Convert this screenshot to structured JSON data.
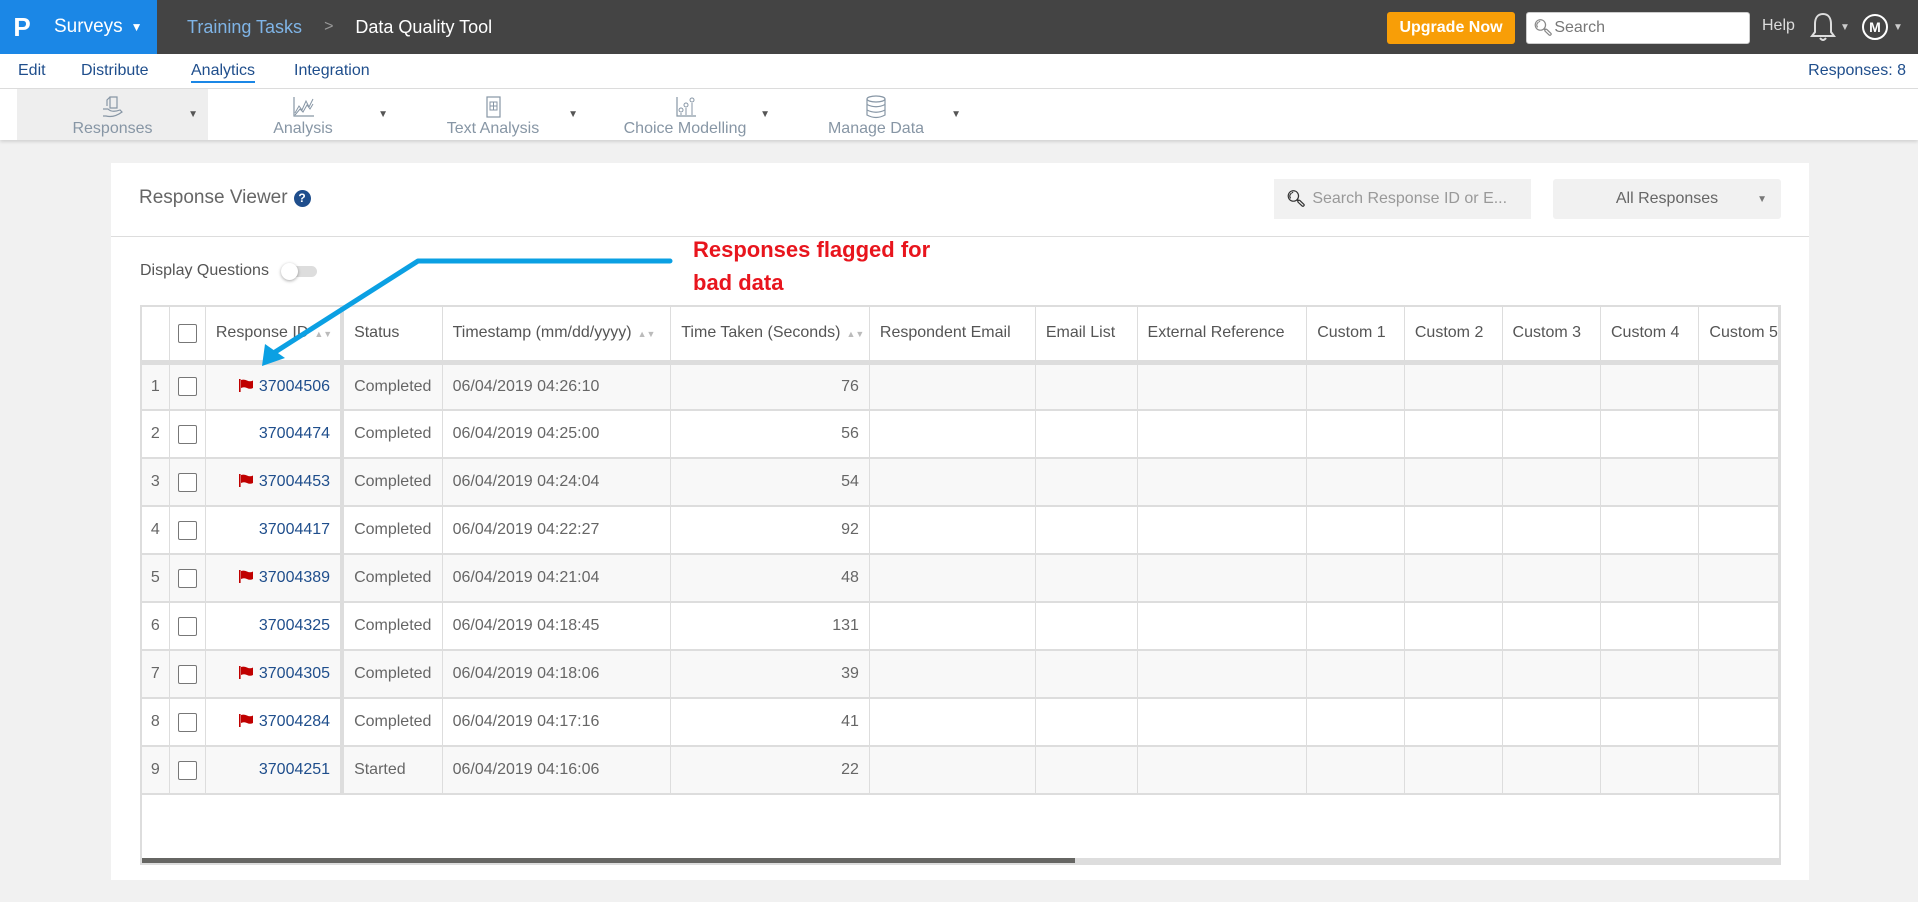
{
  "topbar": {
    "brand_logo": "P",
    "brand_label": "Surveys",
    "breadcrumb": [
      "Training Tasks",
      "Data Quality Tool"
    ],
    "breadcrumb_sep": ">",
    "upgrade_label": "Upgrade Now",
    "search_placeholder": "Search",
    "help_label": "Help",
    "avatar_initial": "M"
  },
  "subnav": {
    "items": [
      "Edit",
      "Distribute",
      "Analytics",
      "Integration"
    ],
    "active": "Analytics",
    "responses_count": "Responses: 8"
  },
  "toolbar": {
    "items": [
      {
        "label": "Responses",
        "icon": "responses-icon",
        "active": true
      },
      {
        "label": "Analysis",
        "icon": "analysis-chart-icon",
        "active": false
      },
      {
        "label": "Text Analysis",
        "icon": "text-analysis-icon",
        "active": false
      },
      {
        "label": "Choice Modelling",
        "icon": "choice-modelling-icon",
        "active": false
      },
      {
        "label": "Manage Data",
        "icon": "database-icon",
        "active": false
      }
    ]
  },
  "viewer": {
    "title": "Response Viewer",
    "help_icon": "?",
    "search_placeholder": "Search Response ID or E...",
    "filter_selected": "All Responses",
    "display_questions_label": "Display Questions",
    "display_questions_on": false
  },
  "table": {
    "columns": [
      "Response ID",
      "Status",
      "Timestamp (mm/dd/yyyy)",
      "Time Taken (Seconds)",
      "Respondent Email",
      "Email List",
      "External Reference",
      "Custom 1",
      "Custom 2",
      "Custom 3",
      "Custom 4",
      "Custom 5"
    ],
    "sortable": [
      "Response ID",
      "Timestamp (mm/dd/yyyy)",
      "Time Taken (Seconds)"
    ],
    "rows": [
      {
        "n": "1",
        "id": "37004506",
        "flagged": true,
        "status": "Completed",
        "timestamp": "06/04/2019 04:26:10",
        "time_taken": "76"
      },
      {
        "n": "2",
        "id": "37004474",
        "flagged": false,
        "status": "Completed",
        "timestamp": "06/04/2019 04:25:00",
        "time_taken": "56"
      },
      {
        "n": "3",
        "id": "37004453",
        "flagged": true,
        "status": "Completed",
        "timestamp": "06/04/2019 04:24:04",
        "time_taken": "54"
      },
      {
        "n": "4",
        "id": "37004417",
        "flagged": false,
        "status": "Completed",
        "timestamp": "06/04/2019 04:22:27",
        "time_taken": "92"
      },
      {
        "n": "5",
        "id": "37004389",
        "flagged": true,
        "status": "Completed",
        "timestamp": "06/04/2019 04:21:04",
        "time_taken": "48"
      },
      {
        "n": "6",
        "id": "37004325",
        "flagged": false,
        "status": "Completed",
        "timestamp": "06/04/2019 04:18:45",
        "time_taken": "131"
      },
      {
        "n": "7",
        "id": "37004305",
        "flagged": true,
        "status": "Completed",
        "timestamp": "06/04/2019 04:18:06",
        "time_taken": "39"
      },
      {
        "n": "8",
        "id": "37004284",
        "flagged": true,
        "status": "Completed",
        "timestamp": "06/04/2019 04:17:16",
        "time_taken": "41"
      },
      {
        "n": "9",
        "id": "37004251",
        "flagged": false,
        "status": "Started",
        "timestamp": "06/04/2019 04:16:06",
        "time_taken": "22"
      }
    ],
    "scroll_fraction": 0.57
  },
  "annotation": {
    "text": "Responses flagged for bad data",
    "color": "#e8151d",
    "arrow_color": "#0ba0e3"
  },
  "colors": {
    "brand_blue": "#1b87e6",
    "topbar_bg": "#444444",
    "upgrade_orange": "#f89e07",
    "link_blue": "#1f4e8c",
    "flag_red": "#c00000"
  }
}
